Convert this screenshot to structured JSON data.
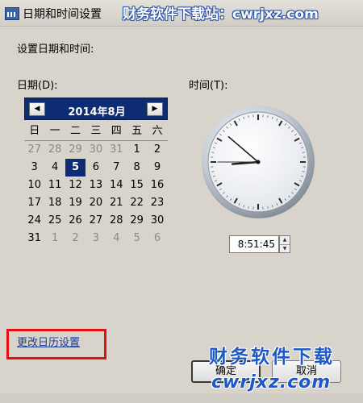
{
  "window": {
    "title": "日期和时间设置",
    "watermark_top": "财务软件下载站：cwrjxz.com"
  },
  "labels": {
    "instruction": "设置日期和时间:",
    "date": "日期(D):",
    "time": "时间(T):"
  },
  "calendar": {
    "month_label": "2014年8月",
    "prev_icon": "◀",
    "next_icon": "▶",
    "weekdays": [
      "日",
      "一",
      "二",
      "三",
      "四",
      "五",
      "六"
    ],
    "selected_day": "5",
    "weeks": [
      [
        "27",
        "28",
        "29",
        "30",
        "31",
        "1",
        "2"
      ],
      [
        "3",
        "4",
        "5",
        "6",
        "7",
        "8",
        "9"
      ],
      [
        "10",
        "11",
        "12",
        "13",
        "14",
        "15",
        "16"
      ],
      [
        "17",
        "18",
        "19",
        "20",
        "21",
        "22",
        "23"
      ],
      [
        "24",
        "25",
        "26",
        "27",
        "28",
        "29",
        "30"
      ],
      [
        "31",
        "1",
        "2",
        "3",
        "4",
        "5",
        "6"
      ]
    ]
  },
  "clock": {
    "hour": 8,
    "minute": 51,
    "second": 45,
    "face_color": "#eef1f4",
    "rim_color": "#9aa3ad"
  },
  "time": {
    "value": "8:51:45",
    "spin_up_icon": "▲",
    "spin_down_icon": "▼"
  },
  "link": {
    "change_calendar": "更改日历设置"
  },
  "buttons": {
    "ok": "确定",
    "cancel": "取消"
  },
  "watermark": {
    "text": "财务软件下载",
    "url": "cwrjxz.com"
  },
  "colors": {
    "calendar_header": "#0d2c73",
    "highlight_box": "#e01010",
    "watermark": "#1d57c8"
  }
}
